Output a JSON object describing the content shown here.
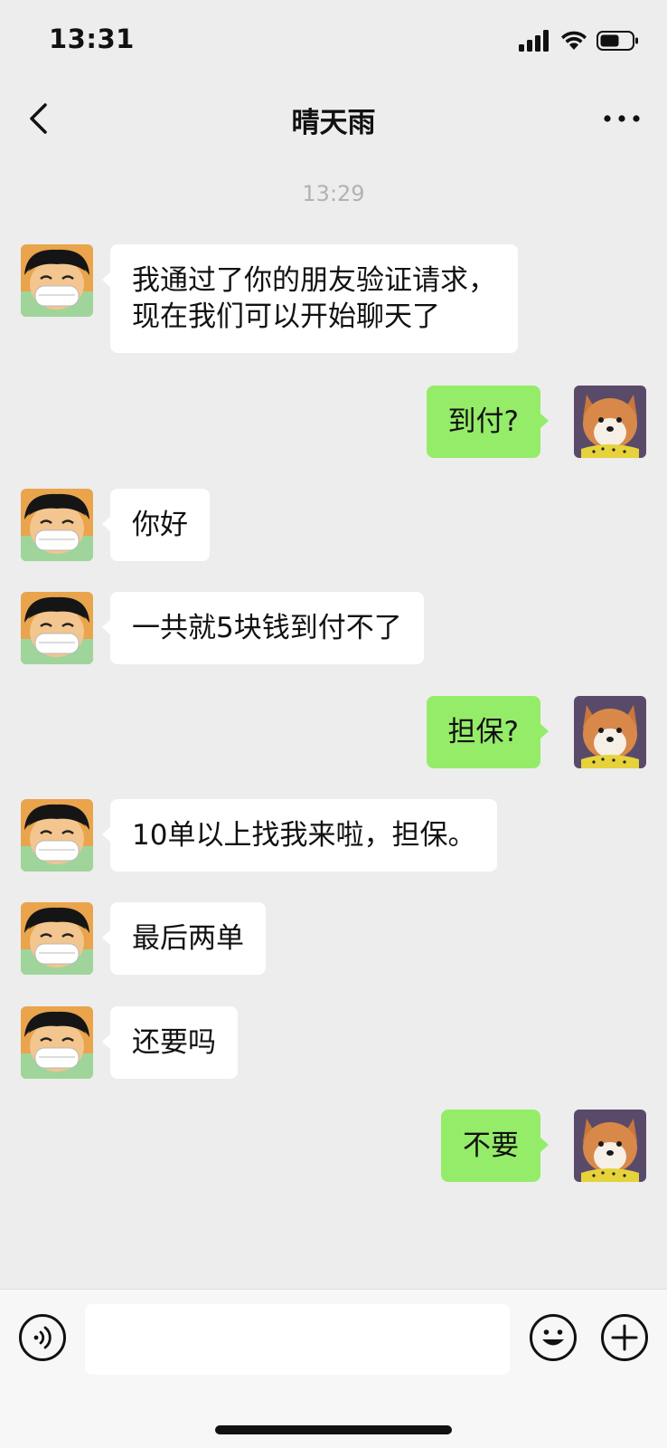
{
  "status_bar": {
    "time": "13:31"
  },
  "header": {
    "title": "晴天雨"
  },
  "timestamp": "13:29",
  "messages": [
    {
      "side": "in",
      "lines": [
        "我通过了你的朋友验证请求，",
        "现在我们可以开始聊天了"
      ]
    },
    {
      "side": "out",
      "text": "到付?"
    },
    {
      "side": "in",
      "text": "你好"
    },
    {
      "side": "in",
      "text": "一共就5块钱到付不了"
    },
    {
      "side": "out",
      "text": "担保?"
    },
    {
      "side": "in",
      "text": "10单以上找我来啦，担保。"
    },
    {
      "side": "in",
      "text": "最后两单"
    },
    {
      "side": "in",
      "text": "还要吗"
    },
    {
      "side": "out",
      "text": "不要"
    }
  ],
  "input": {
    "value": "",
    "placeholder": ""
  },
  "icons": {
    "back": "back-arrow-icon",
    "more": "more-icon",
    "voice": "voice-icon",
    "emoji": "emoji-icon",
    "plus": "plus-icon"
  },
  "colors": {
    "background": "#ededed",
    "incoming_bubble": "#ffffff",
    "outgoing_bubble": "#95ec69",
    "timestamp": "#b2b2b2"
  }
}
